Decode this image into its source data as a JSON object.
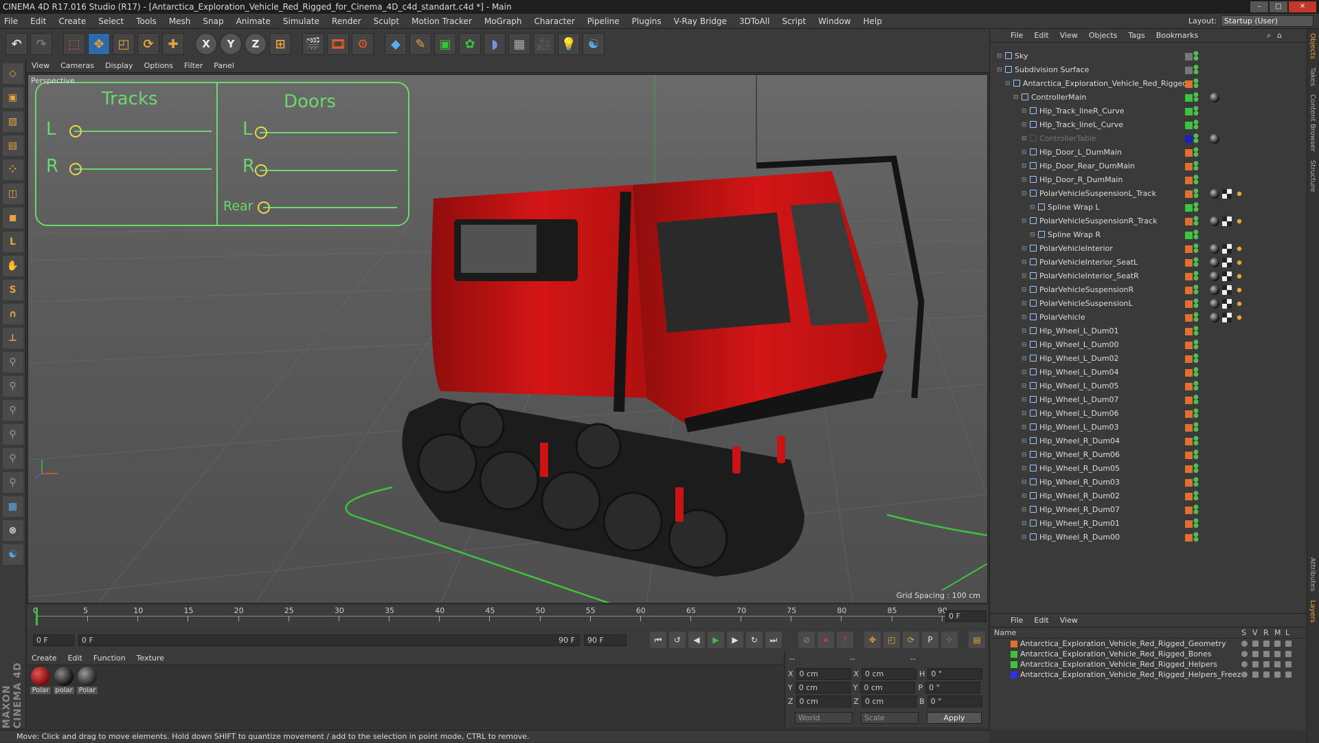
{
  "window": {
    "title": "CINEMA 4D R17.016 Studio (R17) - [Antarctica_Exploration_Vehicle_Red_Rigged_for_Cinema_4D_c4d_standart.c4d *] - Main"
  },
  "menubar": {
    "items": [
      "File",
      "Edit",
      "Create",
      "Select",
      "Tools",
      "Mesh",
      "Snap",
      "Animate",
      "Simulate",
      "Render",
      "Sculpt",
      "Motion Tracker",
      "MoGraph",
      "Character",
      "Pipeline",
      "Plugins",
      "V-Ray Bridge",
      "3DToAll",
      "Script",
      "Window",
      "Help"
    ],
    "layout_label": "Layout:",
    "layout_value": "Startup (User)"
  },
  "toolbar": {
    "icons": [
      "undo-icon",
      "redo-icon",
      "live-selection-icon",
      "move-icon",
      "scale-icon",
      "rotate-icon",
      "last-tool-icon",
      "x-axis-icon",
      "y-axis-icon",
      "z-axis-icon",
      "coordinate-system-icon",
      "render-view-icon",
      "render-picture-viewer-icon",
      "edit-render-settings-icon",
      "cube-icon",
      "pen-icon",
      "subdivision-icon",
      "cloner-icon",
      "deformer-icon",
      "floor-icon",
      "camera-icon",
      "light-icon",
      "python-icon"
    ],
    "axis": {
      "x": "X",
      "y": "Y",
      "z": "Z"
    }
  },
  "viewport": {
    "menu": [
      "View",
      "Cameras",
      "Display",
      "Options",
      "Filter",
      "Panel"
    ],
    "label": "Perspective",
    "grid_spacing": "Grid Spacing : 100 cm",
    "controller": {
      "tracks_title": "Tracks",
      "doors_title": "Doors",
      "tracks_l": "L",
      "tracks_r": "R",
      "doors_l": "L",
      "doors_r": "R",
      "doors_rear": "Rear"
    }
  },
  "timeline": {
    "ticks": [
      "0",
      "5",
      "10",
      "15",
      "20",
      "25",
      "30",
      "35",
      "40",
      "45",
      "50",
      "55",
      "60",
      "65",
      "70",
      "75",
      "80",
      "85",
      "90"
    ],
    "current_frame": "0 F"
  },
  "transport": {
    "start": "0 F",
    "range_start": "0 F",
    "range_end": "90 F",
    "end": "90 F"
  },
  "materials": {
    "menu": [
      "Create",
      "Edit",
      "Function",
      "Texture"
    ],
    "items": [
      {
        "label": "Polar",
        "color": "#8b1a1a"
      },
      {
        "label": "polar",
        "color": "#2a2a2a"
      },
      {
        "label": "Polar",
        "color": "#3a3a3a"
      }
    ]
  },
  "coords": {
    "header": [
      "--",
      "--",
      "--"
    ],
    "rows": [
      {
        "a": "X",
        "av": "0 cm",
        "b": "X",
        "bv": "0 cm",
        "c": "H",
        "cv": "0 °"
      },
      {
        "a": "Y",
        "av": "0 cm",
        "b": "Y",
        "bv": "0 cm",
        "c": "P",
        "cv": "0 °"
      },
      {
        "a": "Z",
        "av": "0 cm",
        "b": "Z",
        "bv": "0 cm",
        "c": "B",
        "cv": "0 °"
      }
    ],
    "mode_world": "World",
    "mode_scale": "Scale",
    "apply": "Apply"
  },
  "status": {
    "text": "Move: Click and drag to move elements. Hold down SHIFT to quantize movement / add to the selection in point mode, CTRL to remove."
  },
  "objects": {
    "menu": [
      "File",
      "Edit",
      "View",
      "Objects",
      "Tags",
      "Bookmarks"
    ],
    "rows": [
      {
        "name": "Sky",
        "indent": 0,
        "color": "#777",
        "dim": false,
        "tags": 0
      },
      {
        "name": "Subdivision Surface",
        "indent": 0,
        "color": "#777",
        "dim": false,
        "tags": 0
      },
      {
        "name": "Antarctica_Exploration_Vehicle_Red_Rigged",
        "indent": 1,
        "color": "#e07030",
        "dim": false,
        "tags": 0
      },
      {
        "name": "ControllerMain",
        "indent": 2,
        "color": "#3cc43c",
        "dim": false,
        "tags": 1
      },
      {
        "name": "Hlp_Track_lineR_Curve",
        "indent": 3,
        "color": "#3cc43c",
        "dim": false,
        "tags": 0
      },
      {
        "name": "Hlp_Track_lineL_Curve",
        "indent": 3,
        "color": "#3cc43c",
        "dim": false,
        "tags": 0
      },
      {
        "name": "ControllerTable",
        "indent": 3,
        "color": "#2020c0",
        "dim": true,
        "tags": 1
      },
      {
        "name": "Hlp_Door_L_DumMain",
        "indent": 3,
        "color": "#e07030",
        "dim": false,
        "tags": 0
      },
      {
        "name": "Hlp_Door_Rear_DumMain",
        "indent": 3,
        "color": "#e07030",
        "dim": false,
        "tags": 0
      },
      {
        "name": "Hlp_Door_R_DumMain",
        "indent": 3,
        "color": "#e07030",
        "dim": false,
        "tags": 0
      },
      {
        "name": "PolarVehicleSuspensionL_Track",
        "indent": 3,
        "color": "#e07030",
        "dim": false,
        "tags": 3
      },
      {
        "name": "Spline Wrap L",
        "indent": 4,
        "color": "#3cc43c",
        "dim": false,
        "tags": 0
      },
      {
        "name": "PolarVehicleSuspensionR_Track",
        "indent": 3,
        "color": "#e07030",
        "dim": false,
        "tags": 3
      },
      {
        "name": "Spline Wrap R",
        "indent": 4,
        "color": "#3cc43c",
        "dim": false,
        "tags": 0
      },
      {
        "name": "PolarVehicleInterior",
        "indent": 3,
        "color": "#e07030",
        "dim": false,
        "tags": 3
      },
      {
        "name": "PolarVehicleInterior_SeatL",
        "indent": 3,
        "color": "#e07030",
        "dim": false,
        "tags": 3
      },
      {
        "name": "PolarVehicleInterior_SeatR",
        "indent": 3,
        "color": "#e07030",
        "dim": false,
        "tags": 3
      },
      {
        "name": "PolarVehicleSuspensionR",
        "indent": 3,
        "color": "#e07030",
        "dim": false,
        "tags": 3
      },
      {
        "name": "PolarVehicleSuspensionL",
        "indent": 3,
        "color": "#e07030",
        "dim": false,
        "tags": 3
      },
      {
        "name": "PolarVehicle",
        "indent": 3,
        "color": "#e07030",
        "dim": false,
        "tags": 3
      },
      {
        "name": "Hlp_Wheel_L_Dum01",
        "indent": 3,
        "color": "#e07030",
        "dim": false,
        "tags": 0
      },
      {
        "name": "Hlp_Wheel_L_Dum00",
        "indent": 3,
        "color": "#e07030",
        "dim": false,
        "tags": 0
      },
      {
        "name": "Hlp_Wheel_L_Dum02",
        "indent": 3,
        "color": "#e07030",
        "dim": false,
        "tags": 0
      },
      {
        "name": "Hlp_Wheel_L_Dum04",
        "indent": 3,
        "color": "#e07030",
        "dim": false,
        "tags": 0
      },
      {
        "name": "Hlp_Wheel_L_Dum05",
        "indent": 3,
        "color": "#e07030",
        "dim": false,
        "tags": 0
      },
      {
        "name": "Hlp_Wheel_L_Dum07",
        "indent": 3,
        "color": "#e07030",
        "dim": false,
        "tags": 0
      },
      {
        "name": "Hlp_Wheel_L_Dum06",
        "indent": 3,
        "color": "#e07030",
        "dim": false,
        "tags": 0
      },
      {
        "name": "Hlp_Wheel_L_Dum03",
        "indent": 3,
        "color": "#e07030",
        "dim": false,
        "tags": 0
      },
      {
        "name": "Hlp_Wheel_R_Dum04",
        "indent": 3,
        "color": "#e07030",
        "dim": false,
        "tags": 0
      },
      {
        "name": "Hlp_Wheel_R_Dum06",
        "indent": 3,
        "color": "#e07030",
        "dim": false,
        "tags": 0
      },
      {
        "name": "Hlp_Wheel_R_Dum05",
        "indent": 3,
        "color": "#e07030",
        "dim": false,
        "tags": 0
      },
      {
        "name": "Hlp_Wheel_R_Dum03",
        "indent": 3,
        "color": "#e07030",
        "dim": false,
        "tags": 0
      },
      {
        "name": "Hlp_Wheel_R_Dum02",
        "indent": 3,
        "color": "#e07030",
        "dim": false,
        "tags": 0
      },
      {
        "name": "Hlp_Wheel_R_Dum07",
        "indent": 3,
        "color": "#e07030",
        "dim": false,
        "tags": 0
      },
      {
        "name": "Hlp_Wheel_R_Dum01",
        "indent": 3,
        "color": "#e07030",
        "dim": false,
        "tags": 0
      },
      {
        "name": "Hlp_Wheel_R_Dum00",
        "indent": 3,
        "color": "#e07030",
        "dim": false,
        "tags": 0
      }
    ]
  },
  "layers": {
    "menu": [
      "File",
      "Edit",
      "View"
    ],
    "header_name": "Name",
    "header_flags": [
      "S",
      "V",
      "R",
      "M",
      "L"
    ],
    "rows": [
      {
        "name": "Antarctica_Exploration_Vehicle_Red_Rigged_Geometry",
        "color": "#e07030"
      },
      {
        "name": "Antarctica_Exploration_Vehicle_Red_Rigged_Bones",
        "color": "#3cc43c"
      },
      {
        "name": "Antarctica_Exploration_Vehicle_Red_Rigged_Helpers",
        "color": "#3cc43c"
      },
      {
        "name": "Antarctica_Exploration_Vehicle_Red_Rigged_Helpers_Freeze",
        "color": "#3030e0"
      }
    ]
  },
  "right_tabs": [
    "Objects",
    "Takes",
    "Content Browser",
    "Structure",
    "Attributes",
    "Layers"
  ]
}
